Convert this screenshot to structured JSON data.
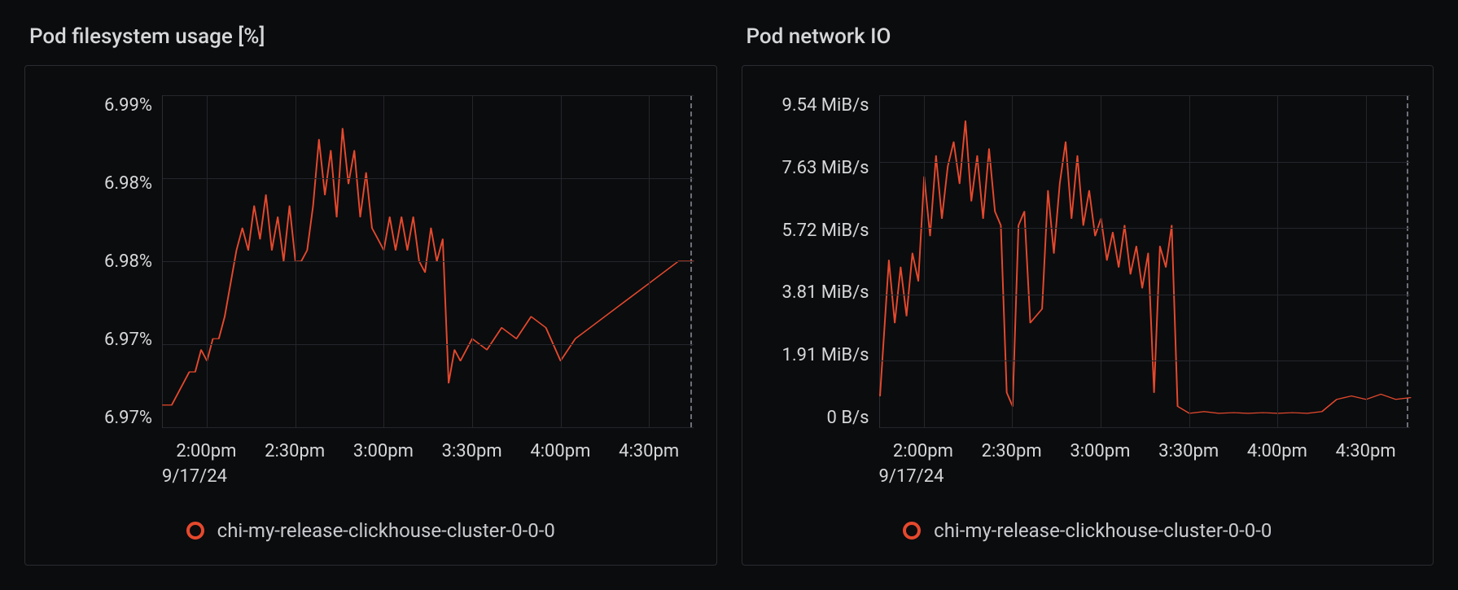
{
  "panels": [
    {
      "id": "fs",
      "title": "Pod filesystem usage [%]"
    },
    {
      "id": "net",
      "title": "Pod network IO"
    }
  ],
  "legend_label": "chi-my-release-clickhouse-cluster-0-0-0",
  "x_date": "9/17/24",
  "colors": {
    "series": "#e5492d"
  },
  "chart_data": [
    {
      "id": "fs",
      "type": "line",
      "title": "Pod filesystem usage [%]",
      "xlabel": "",
      "ylabel": "",
      "x_ticks": [
        "2:00pm",
        "2:30pm",
        "3:00pm",
        "3:30pm",
        "4:00pm",
        "4:30pm"
      ],
      "x_range_minutes": [
        105,
        285
      ],
      "y_ticks": [
        "6.99%",
        "6.98%",
        "6.98%",
        "6.97%",
        "6.97%"
      ],
      "ylim": [
        6.965,
        6.995
      ],
      "series": [
        {
          "name": "chi-my-release-clickhouse-cluster-0-0-0",
          "x_min": [
            105,
            108,
            110,
            112,
            114,
            116,
            118,
            120,
            122,
            124,
            126,
            128,
            130,
            132,
            134,
            136,
            138,
            140,
            142,
            144,
            146,
            148,
            150,
            152,
            154,
            156,
            158,
            160,
            162,
            164,
            166,
            168,
            170,
            172,
            174,
            176,
            178,
            180,
            182,
            184,
            186,
            188,
            190,
            192,
            194,
            196,
            198,
            200,
            202,
            204,
            206,
            210,
            215,
            220,
            225,
            230,
            235,
            240,
            245,
            250,
            255,
            260,
            265,
            270,
            275,
            280,
            285
          ],
          "values": [
            6.967,
            6.967,
            6.968,
            6.969,
            6.97,
            6.97,
            6.972,
            6.971,
            6.973,
            6.973,
            6.975,
            6.978,
            6.981,
            6.983,
            6.981,
            6.985,
            6.982,
            6.986,
            6.981,
            6.984,
            6.98,
            6.985,
            6.98,
            6.98,
            6.981,
            6.985,
            6.991,
            6.986,
            6.99,
            6.984,
            6.992,
            6.987,
            6.99,
            6.984,
            6.988,
            6.983,
            6.982,
            6.981,
            6.984,
            6.981,
            6.984,
            6.981,
            6.984,
            6.98,
            6.979,
            6.983,
            6.98,
            6.982,
            6.969,
            6.972,
            6.971,
            6.973,
            6.972,
            6.974,
            6.973,
            6.975,
            6.974,
            6.971,
            6.973,
            6.974,
            6.975,
            6.976,
            6.977,
            6.978,
            6.979,
            6.98,
            6.98
          ]
        }
      ]
    },
    {
      "id": "net",
      "type": "line",
      "title": "Pod network IO",
      "xlabel": "",
      "ylabel": "",
      "x_ticks": [
        "2:00pm",
        "2:30pm",
        "3:00pm",
        "3:30pm",
        "4:00pm",
        "4:30pm"
      ],
      "x_range_minutes": [
        105,
        285
      ],
      "y_ticks": [
        "9.54 MiB/s",
        "7.63 MiB/s",
        "5.72 MiB/s",
        "3.81 MiB/s",
        "1.91 MiB/s",
        "0 B/s"
      ],
      "ylim": [
        0,
        9.54
      ],
      "series": [
        {
          "name": "chi-my-release-clickhouse-cluster-0-0-0",
          "x_min": [
            105,
            108,
            110,
            112,
            114,
            116,
            118,
            120,
            122,
            124,
            126,
            128,
            130,
            132,
            134,
            136,
            138,
            140,
            142,
            144,
            146,
            148,
            150,
            152,
            154,
            156,
            158,
            160,
            162,
            164,
            166,
            168,
            170,
            172,
            174,
            176,
            178,
            180,
            182,
            184,
            186,
            188,
            190,
            192,
            194,
            196,
            198,
            200,
            202,
            204,
            206,
            210,
            215,
            220,
            225,
            230,
            235,
            240,
            245,
            250,
            255,
            260,
            265,
            270,
            275,
            280,
            285
          ],
          "values": [
            0.9,
            4.8,
            3.0,
            4.6,
            3.2,
            5.0,
            4.2,
            7.2,
            5.5,
            7.8,
            6.0,
            7.5,
            8.2,
            7.0,
            8.8,
            6.5,
            7.8,
            6.0,
            8.0,
            6.2,
            5.8,
            1.0,
            0.6,
            5.8,
            6.2,
            3.0,
            3.2,
            3.4,
            6.8,
            5.0,
            7.0,
            8.2,
            6.0,
            7.8,
            5.8,
            6.8,
            5.5,
            6.0,
            4.8,
            5.6,
            4.6,
            5.8,
            4.4,
            5.2,
            4.0,
            5.0,
            1.0,
            5.2,
            4.6,
            5.8,
            0.6,
            0.4,
            0.45,
            0.4,
            0.42,
            0.4,
            0.42,
            0.4,
            0.42,
            0.4,
            0.45,
            0.8,
            0.9,
            0.8,
            0.95,
            0.8,
            0.85
          ]
        }
      ]
    }
  ]
}
